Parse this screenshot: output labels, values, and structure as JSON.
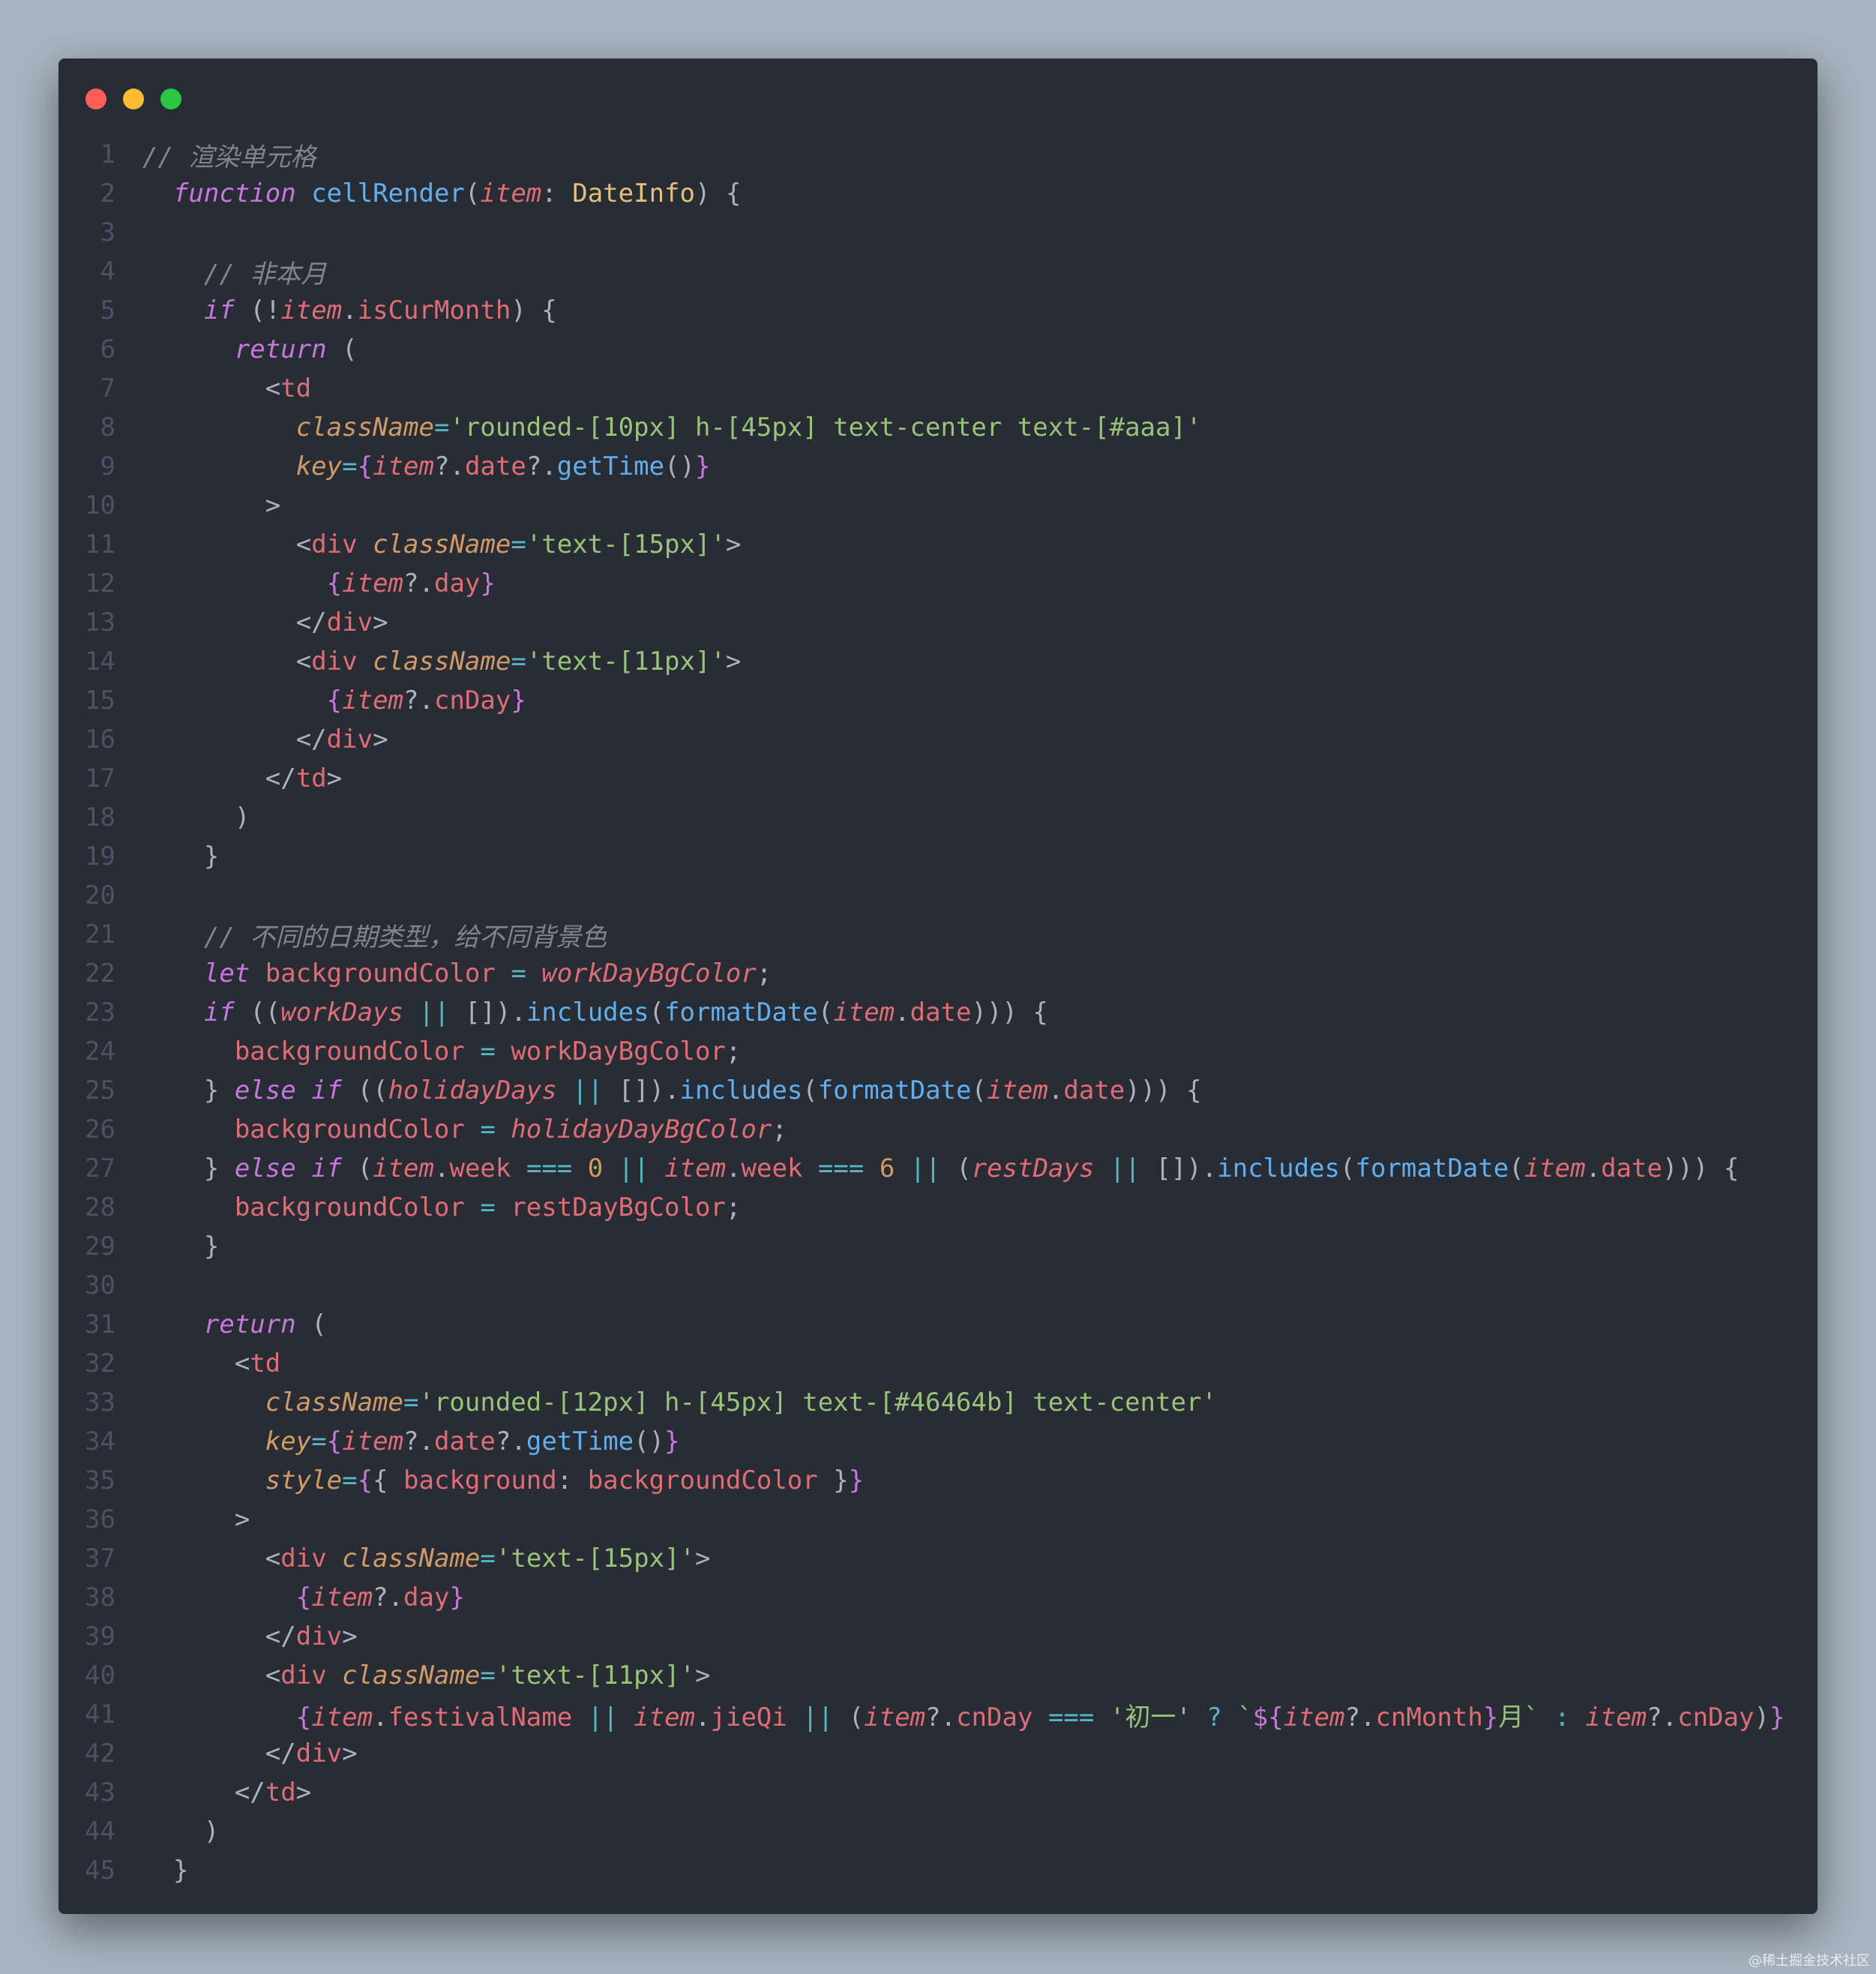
{
  "window": {
    "traffic_lights": [
      {
        "name": "close",
        "color": "#ff5f57"
      },
      {
        "name": "minimize",
        "color": "#febc2e"
      },
      {
        "name": "zoom",
        "color": "#28c840"
      }
    ]
  },
  "watermark": "@稀土掘金技术社区",
  "lines": [
    {
      "n": "1",
      "indent": 0,
      "tokens": [
        [
          "comment",
          "// 渲染单元格"
        ]
      ]
    },
    {
      "n": "2",
      "indent": 1,
      "tokens": [
        [
          "keyword",
          "function"
        ],
        [
          "punc",
          " "
        ],
        [
          "func",
          "cellRender"
        ],
        [
          "punc",
          "("
        ],
        [
          "param",
          "item"
        ],
        [
          "punc",
          ": "
        ],
        [
          "type",
          "DateInfo"
        ],
        [
          "punc",
          ") {"
        ]
      ]
    },
    {
      "n": "3",
      "indent": 0,
      "tokens": []
    },
    {
      "n": "4",
      "indent": 2,
      "tokens": [
        [
          "comment",
          "// 非本月"
        ]
      ]
    },
    {
      "n": "5",
      "indent": 2,
      "tokens": [
        [
          "keyword",
          "if"
        ],
        [
          "punc",
          " (!"
        ],
        [
          "param",
          "item"
        ],
        [
          "punc",
          "."
        ],
        [
          "prop",
          "isCurMonth"
        ],
        [
          "punc",
          ") {"
        ]
      ]
    },
    {
      "n": "6",
      "indent": 3,
      "tokens": [
        [
          "keyword",
          "return"
        ],
        [
          "punc",
          " ("
        ]
      ]
    },
    {
      "n": "7",
      "indent": 4,
      "tokens": [
        [
          "punc",
          "<"
        ],
        [
          "tag",
          "td"
        ]
      ]
    },
    {
      "n": "8",
      "indent": 5,
      "tokens": [
        [
          "attr",
          "className"
        ],
        [
          "op",
          "="
        ],
        [
          "string",
          "'rounded-[10px] h-[45px] text-center text-[#aaa]'"
        ]
      ]
    },
    {
      "n": "9",
      "indent": 5,
      "tokens": [
        [
          "attr",
          "key"
        ],
        [
          "op",
          "="
        ],
        [
          "brace",
          "{"
        ],
        [
          "param",
          "item"
        ],
        [
          "punc",
          "?."
        ],
        [
          "prop",
          "date"
        ],
        [
          "punc",
          "?."
        ],
        [
          "func",
          "getTime"
        ],
        [
          "punc",
          "()"
        ],
        [
          "brace",
          "}"
        ]
      ]
    },
    {
      "n": "10",
      "indent": 4,
      "tokens": [
        [
          "punc",
          ">"
        ]
      ]
    },
    {
      "n": "11",
      "indent": 5,
      "tokens": [
        [
          "punc",
          "<"
        ],
        [
          "tag",
          "div"
        ],
        [
          "punc",
          " "
        ],
        [
          "attr",
          "className"
        ],
        [
          "op",
          "="
        ],
        [
          "string",
          "'text-[15px]'"
        ],
        [
          "punc",
          ">"
        ]
      ]
    },
    {
      "n": "12",
      "indent": 6,
      "tokens": [
        [
          "brace",
          "{"
        ],
        [
          "param",
          "item"
        ],
        [
          "punc",
          "?."
        ],
        [
          "prop",
          "day"
        ],
        [
          "brace",
          "}"
        ]
      ]
    },
    {
      "n": "13",
      "indent": 5,
      "tokens": [
        [
          "punc",
          "</"
        ],
        [
          "tag",
          "div"
        ],
        [
          "punc",
          ">"
        ]
      ]
    },
    {
      "n": "14",
      "indent": 5,
      "tokens": [
        [
          "punc",
          "<"
        ],
        [
          "tag",
          "div"
        ],
        [
          "punc",
          " "
        ],
        [
          "attr",
          "className"
        ],
        [
          "op",
          "="
        ],
        [
          "string",
          "'text-[11px]'"
        ],
        [
          "punc",
          ">"
        ]
      ]
    },
    {
      "n": "15",
      "indent": 6,
      "tokens": [
        [
          "brace",
          "{"
        ],
        [
          "param",
          "item"
        ],
        [
          "punc",
          "?."
        ],
        [
          "prop",
          "cnDay"
        ],
        [
          "brace",
          "}"
        ]
      ]
    },
    {
      "n": "16",
      "indent": 5,
      "tokens": [
        [
          "punc",
          "</"
        ],
        [
          "tag",
          "div"
        ],
        [
          "punc",
          ">"
        ]
      ]
    },
    {
      "n": "17",
      "indent": 4,
      "tokens": [
        [
          "punc",
          "</"
        ],
        [
          "tag",
          "td"
        ],
        [
          "punc",
          ">"
        ]
      ]
    },
    {
      "n": "18",
      "indent": 3,
      "tokens": [
        [
          "punc",
          ")"
        ]
      ]
    },
    {
      "n": "19",
      "indent": 2,
      "tokens": [
        [
          "punc",
          "}"
        ]
      ]
    },
    {
      "n": "20",
      "indent": 0,
      "tokens": []
    },
    {
      "n": "21",
      "indent": 2,
      "tokens": [
        [
          "comment",
          "// 不同的日期类型，给不同背景色"
        ]
      ]
    },
    {
      "n": "22",
      "indent": 2,
      "tokens": [
        [
          "keyword",
          "let"
        ],
        [
          "punc",
          " "
        ],
        [
          "var",
          "backgroundColor"
        ],
        [
          "punc",
          " "
        ],
        [
          "op",
          "="
        ],
        [
          "punc",
          " "
        ],
        [
          "global",
          "workDayBgColor"
        ],
        [
          "punc",
          ";"
        ]
      ]
    },
    {
      "n": "23",
      "indent": 2,
      "tokens": [
        [
          "keyword",
          "if"
        ],
        [
          "punc",
          " (("
        ],
        [
          "global",
          "workDays"
        ],
        [
          "punc",
          " "
        ],
        [
          "op",
          "||"
        ],
        [
          "punc",
          " [])."
        ],
        [
          "func",
          "includes"
        ],
        [
          "punc",
          "("
        ],
        [
          "func",
          "formatDate"
        ],
        [
          "punc",
          "("
        ],
        [
          "param",
          "item"
        ],
        [
          "punc",
          "."
        ],
        [
          "prop",
          "date"
        ],
        [
          "punc",
          ")))"
        ],
        [
          "punc",
          " {"
        ]
      ]
    },
    {
      "n": "24",
      "indent": 3,
      "tokens": [
        [
          "var",
          "backgroundColor"
        ],
        [
          "punc",
          " "
        ],
        [
          "op",
          "="
        ],
        [
          "punc",
          " "
        ],
        [
          "var",
          "workDayBgColor"
        ],
        [
          "punc",
          ";"
        ]
      ]
    },
    {
      "n": "25",
      "indent": 2,
      "tokens": [
        [
          "punc",
          "} "
        ],
        [
          "keyword",
          "else if"
        ],
        [
          "punc",
          " (("
        ],
        [
          "global",
          "holidayDays"
        ],
        [
          "punc",
          " "
        ],
        [
          "op",
          "||"
        ],
        [
          "punc",
          " [])."
        ],
        [
          "func",
          "includes"
        ],
        [
          "punc",
          "("
        ],
        [
          "func",
          "formatDate"
        ],
        [
          "punc",
          "("
        ],
        [
          "param",
          "item"
        ],
        [
          "punc",
          "."
        ],
        [
          "prop",
          "date"
        ],
        [
          "punc",
          ")))"
        ],
        [
          "punc",
          " {"
        ]
      ]
    },
    {
      "n": "26",
      "indent": 3,
      "tokens": [
        [
          "var",
          "backgroundColor"
        ],
        [
          "punc",
          " "
        ],
        [
          "op",
          "="
        ],
        [
          "punc",
          " "
        ],
        [
          "global",
          "holidayDayBgColor"
        ],
        [
          "punc",
          ";"
        ]
      ]
    },
    {
      "n": "27",
      "indent": 2,
      "tokens": [
        [
          "punc",
          "} "
        ],
        [
          "keyword",
          "else if"
        ],
        [
          "punc",
          " ("
        ],
        [
          "param",
          "item"
        ],
        [
          "punc",
          "."
        ],
        [
          "prop",
          "week"
        ],
        [
          "punc",
          " "
        ],
        [
          "op",
          "==="
        ],
        [
          "punc",
          " "
        ],
        [
          "num",
          "0"
        ],
        [
          "punc",
          " "
        ],
        [
          "op",
          "||"
        ],
        [
          "punc",
          " "
        ],
        [
          "param",
          "item"
        ],
        [
          "punc",
          "."
        ],
        [
          "prop",
          "week"
        ],
        [
          "punc",
          " "
        ],
        [
          "op",
          "==="
        ],
        [
          "punc",
          " "
        ],
        [
          "num",
          "6"
        ],
        [
          "punc",
          " "
        ],
        [
          "op",
          "||"
        ],
        [
          "punc",
          " ("
        ],
        [
          "global",
          "restDays"
        ],
        [
          "punc",
          " "
        ],
        [
          "op",
          "||"
        ],
        [
          "punc",
          " [])."
        ],
        [
          "func",
          "includes"
        ],
        [
          "punc",
          "("
        ],
        [
          "func",
          "formatDate"
        ],
        [
          "punc",
          "("
        ],
        [
          "param",
          "item"
        ],
        [
          "punc",
          "."
        ],
        [
          "prop",
          "date"
        ],
        [
          "punc",
          ")))"
        ],
        [
          "punc",
          " {"
        ]
      ]
    },
    {
      "n": "28",
      "indent": 3,
      "tokens": [
        [
          "var",
          "backgroundColor"
        ],
        [
          "punc",
          " "
        ],
        [
          "op",
          "="
        ],
        [
          "punc",
          " "
        ],
        [
          "var",
          "restDayBgColor"
        ],
        [
          "punc",
          ";"
        ]
      ]
    },
    {
      "n": "29",
      "indent": 2,
      "tokens": [
        [
          "punc",
          "}"
        ]
      ]
    },
    {
      "n": "30",
      "indent": 0,
      "tokens": []
    },
    {
      "n": "31",
      "indent": 2,
      "tokens": [
        [
          "keyword",
          "return"
        ],
        [
          "punc",
          " ("
        ]
      ]
    },
    {
      "n": "32",
      "indent": 3,
      "tokens": [
        [
          "punc",
          "<"
        ],
        [
          "tag",
          "td"
        ]
      ]
    },
    {
      "n": "33",
      "indent": 4,
      "tokens": [
        [
          "attr",
          "className"
        ],
        [
          "op",
          "="
        ],
        [
          "string",
          "'rounded-[12px] h-[45px] text-[#46464b] text-center'"
        ]
      ]
    },
    {
      "n": "34",
      "indent": 4,
      "tokens": [
        [
          "attr",
          "key"
        ],
        [
          "op",
          "="
        ],
        [
          "brace",
          "{"
        ],
        [
          "param",
          "item"
        ],
        [
          "punc",
          "?."
        ],
        [
          "prop",
          "date"
        ],
        [
          "punc",
          "?."
        ],
        [
          "func",
          "getTime"
        ],
        [
          "punc",
          "()"
        ],
        [
          "brace",
          "}"
        ]
      ]
    },
    {
      "n": "35",
      "indent": 4,
      "tokens": [
        [
          "attr",
          "style"
        ],
        [
          "op",
          "="
        ],
        [
          "brace",
          "{"
        ],
        [
          "punc",
          "{ "
        ],
        [
          "prop",
          "background"
        ],
        [
          "punc",
          ": "
        ],
        [
          "var",
          "backgroundColor"
        ],
        [
          "punc",
          " }"
        ],
        [
          "brace",
          "}"
        ]
      ]
    },
    {
      "n": "36",
      "indent": 3,
      "tokens": [
        [
          "punc",
          ">"
        ]
      ]
    },
    {
      "n": "37",
      "indent": 4,
      "tokens": [
        [
          "punc",
          "<"
        ],
        [
          "tag",
          "div"
        ],
        [
          "punc",
          " "
        ],
        [
          "attr",
          "className"
        ],
        [
          "op",
          "="
        ],
        [
          "string",
          "'text-[15px]'"
        ],
        [
          "punc",
          ">"
        ]
      ]
    },
    {
      "n": "38",
      "indent": 5,
      "tokens": [
        [
          "brace",
          "{"
        ],
        [
          "param",
          "item"
        ],
        [
          "punc",
          "?."
        ],
        [
          "prop",
          "day"
        ],
        [
          "brace",
          "}"
        ]
      ]
    },
    {
      "n": "39",
      "indent": 4,
      "tokens": [
        [
          "punc",
          "</"
        ],
        [
          "tag",
          "div"
        ],
        [
          "punc",
          ">"
        ]
      ]
    },
    {
      "n": "40",
      "indent": 4,
      "tokens": [
        [
          "punc",
          "<"
        ],
        [
          "tag",
          "div"
        ],
        [
          "punc",
          " "
        ],
        [
          "attr",
          "className"
        ],
        [
          "op",
          "="
        ],
        [
          "string",
          "'text-[11px]'"
        ],
        [
          "punc",
          ">"
        ]
      ]
    },
    {
      "n": "41",
      "indent": 5,
      "tokens": [
        [
          "brace",
          "{"
        ],
        [
          "param",
          "item"
        ],
        [
          "punc",
          "."
        ],
        [
          "prop",
          "festivalName"
        ],
        [
          "punc",
          " "
        ],
        [
          "op",
          "||"
        ],
        [
          "punc",
          " "
        ],
        [
          "param",
          "item"
        ],
        [
          "punc",
          "."
        ],
        [
          "prop",
          "jieQi"
        ],
        [
          "punc",
          " "
        ],
        [
          "op",
          "||"
        ],
        [
          "punc",
          " ("
        ],
        [
          "param",
          "item"
        ],
        [
          "punc",
          "?."
        ],
        [
          "prop",
          "cnDay"
        ],
        [
          "punc",
          " "
        ],
        [
          "op",
          "==="
        ],
        [
          "punc",
          " "
        ],
        [
          "string",
          "'初一'"
        ],
        [
          "punc",
          " "
        ],
        [
          "op",
          "?"
        ],
        [
          "punc",
          " "
        ],
        [
          "string",
          "`"
        ],
        [
          "brace",
          "${"
        ],
        [
          "param",
          "item"
        ],
        [
          "punc",
          "?."
        ],
        [
          "prop",
          "cnMonth"
        ],
        [
          "brace",
          "}"
        ],
        [
          "string",
          "月`"
        ],
        [
          "punc",
          " "
        ],
        [
          "op",
          ":"
        ],
        [
          "punc",
          " "
        ],
        [
          "param",
          "item"
        ],
        [
          "punc",
          "?."
        ],
        [
          "prop",
          "cnDay"
        ],
        [
          "punc",
          ")"
        ],
        [
          "brace",
          "}"
        ]
      ]
    },
    {
      "n": "42",
      "indent": 4,
      "tokens": [
        [
          "punc",
          "</"
        ],
        [
          "tag",
          "div"
        ],
        [
          "punc",
          ">"
        ]
      ]
    },
    {
      "n": "43",
      "indent": 3,
      "tokens": [
        [
          "punc",
          "</"
        ],
        [
          "tag",
          "td"
        ],
        [
          "punc",
          ">"
        ]
      ]
    },
    {
      "n": "44",
      "indent": 2,
      "tokens": [
        [
          "punc",
          ")"
        ]
      ]
    },
    {
      "n": "45",
      "indent": 1,
      "tokens": [
        [
          "punc",
          "}"
        ]
      ]
    }
  ]
}
